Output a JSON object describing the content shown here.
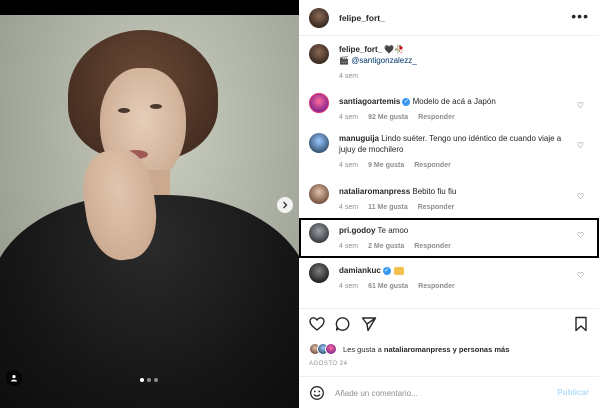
{
  "post": {
    "author": "felipe_fort_",
    "caption": {
      "author": "felipe_fort_",
      "emoji": "🖤🥀",
      "line2_prefix": "🎬",
      "mention": "@santigonzalezz_",
      "time": "4 sem"
    }
  },
  "comments": [
    {
      "user": "santiagoartemis",
      "verified": true,
      "text": "Modelo de acá a Japón",
      "time": "4 sem",
      "likes": "92 Me gusta",
      "reply": "Responder"
    },
    {
      "user": "manuguija",
      "verified": false,
      "text": "Lindo suéter. Tengo uno idéntico de cuando viaje a jujuy de mochilero",
      "time": "4 sem",
      "likes": "9 Me gusta",
      "reply": "Responder"
    },
    {
      "user": "nataliaromanpress",
      "verified": false,
      "text": "Bebito fiu fiu",
      "time": "4 sem",
      "likes": "11 Me gusta",
      "reply": "Responder"
    },
    {
      "user": "pri.godoy",
      "verified": false,
      "text": "Te amoo",
      "time": "4 sem",
      "likes": "2 Me gusta",
      "reply": "Responder"
    },
    {
      "user": "damiankuc",
      "verified": true,
      "text": "",
      "time": "4 sem",
      "likes": "61 Me gusta",
      "reply": "Responder"
    }
  ],
  "likes_line": {
    "prefix": "Les gusta a",
    "user": "nataliaromanpress",
    "suffix": "y personas más"
  },
  "date": "AGOSTO 24",
  "composer": {
    "placeholder": "Añade un comentario...",
    "publish": "Publicar"
  },
  "icons": {
    "more": "more-horizontal-icon",
    "heart": "heart-icon",
    "comment": "comment-icon",
    "share": "share-icon",
    "bookmark": "bookmark-icon",
    "emoji": "emoji-icon",
    "next": "chevron-right-icon",
    "tag": "user-tag-icon"
  },
  "colors": {
    "accent": "#3897f0",
    "publish_disabled": "#b2dffc",
    "muted": "#8e8e8e"
  }
}
